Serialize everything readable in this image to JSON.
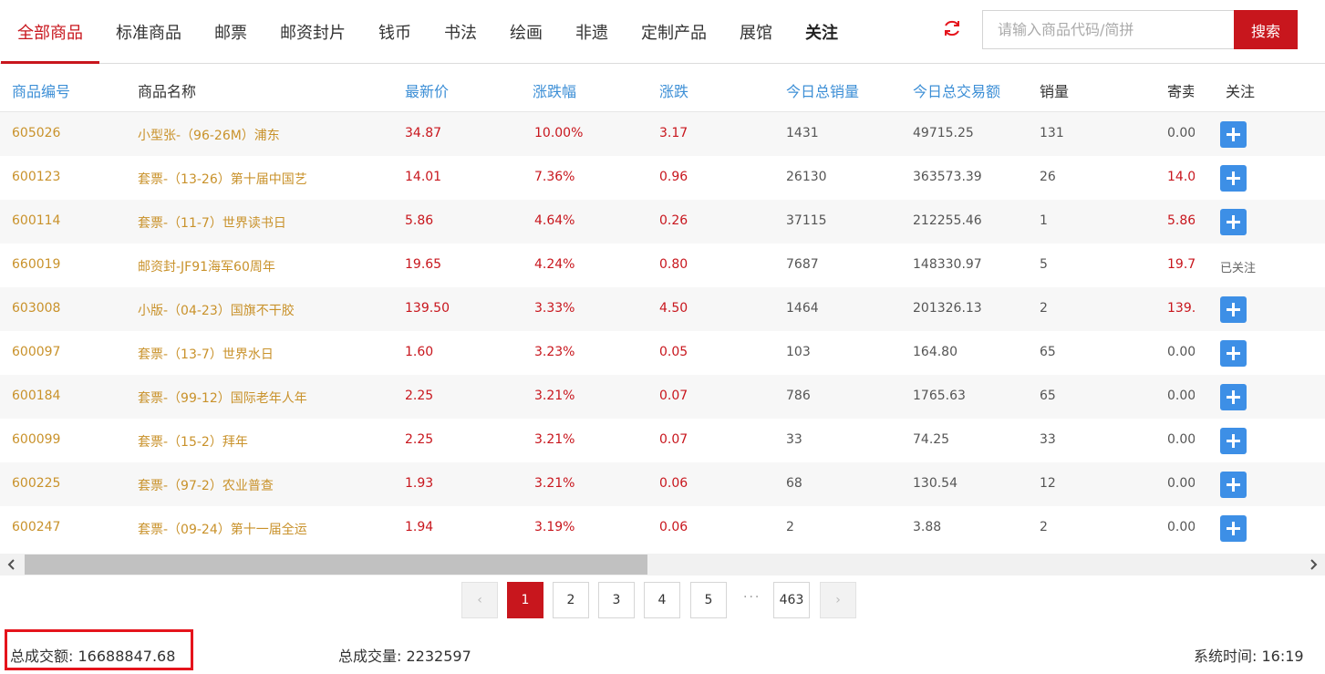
{
  "nav": {
    "tabs": [
      "全部商品",
      "标准商品",
      "邮票",
      "邮资封片",
      "钱币",
      "书法",
      "绘画",
      "非遗",
      "定制产品",
      "展馆",
      "关注"
    ],
    "active_tab": "全部商品"
  },
  "search": {
    "placeholder": "请输入商品代码/简拼",
    "button_label": "搜索"
  },
  "table": {
    "headers": [
      "商品编号",
      "商品名称",
      "最新价",
      "涨跌幅",
      "涨跌",
      "今日总销量",
      "今日总交易额",
      "销量",
      "寄卖",
      "关注"
    ],
    "rows": [
      {
        "code": "605026",
        "name": "小型张-（96-26M）浦东",
        "price": "34.87",
        "pct": "10.00%",
        "chg": "3.17",
        "vol": "1431",
        "amount": "49715.25",
        "sales": "131",
        "consign": "0.00",
        "followed": false
      },
      {
        "code": "600123",
        "name": "套票-（13-26）第十届中国艺",
        "price": "14.01",
        "pct": "7.36%",
        "chg": "0.96",
        "vol": "26130",
        "amount": "363573.39",
        "sales": "26",
        "consign": "14.0",
        "followed": false
      },
      {
        "code": "600114",
        "name": "套票-（11-7）世界读书日",
        "price": "5.86",
        "pct": "4.64%",
        "chg": "0.26",
        "vol": "37115",
        "amount": "212255.46",
        "sales": "1",
        "consign": "5.86",
        "followed": false
      },
      {
        "code": "660019",
        "name": "邮资封-JF91海军60周年",
        "price": "19.65",
        "pct": "4.24%",
        "chg": "0.80",
        "vol": "7687",
        "amount": "148330.97",
        "sales": "5",
        "consign": "19.7",
        "followed": true,
        "followed_label": "已关注"
      },
      {
        "code": "603008",
        "name": "小版-（04-23）国旗不干胶",
        "price": "139.50",
        "pct": "3.33%",
        "chg": "4.50",
        "vol": "1464",
        "amount": "201326.13",
        "sales": "2",
        "consign": "139.",
        "followed": false
      },
      {
        "code": "600097",
        "name": "套票-（13-7）世界水日",
        "price": "1.60",
        "pct": "3.23%",
        "chg": "0.05",
        "vol": "103",
        "amount": "164.80",
        "sales": "65",
        "consign": "0.00",
        "followed": false
      },
      {
        "code": "600184",
        "name": "套票-（99-12）国际老年人年",
        "price": "2.25",
        "pct": "3.21%",
        "chg": "0.07",
        "vol": "786",
        "amount": "1765.63",
        "sales": "65",
        "consign": "0.00",
        "followed": false
      },
      {
        "code": "600099",
        "name": "套票-（15-2）拜年",
        "price": "2.25",
        "pct": "3.21%",
        "chg": "0.07",
        "vol": "33",
        "amount": "74.25",
        "sales": "33",
        "consign": "0.00",
        "followed": false
      },
      {
        "code": "600225",
        "name": "套票-（97-2）农业普查",
        "price": "1.93",
        "pct": "3.21%",
        "chg": "0.06",
        "vol": "68",
        "amount": "130.54",
        "sales": "12",
        "consign": "0.00",
        "followed": false
      },
      {
        "code": "600247",
        "name": "套票-（09-24）第十一届全运",
        "price": "1.94",
        "pct": "3.19%",
        "chg": "0.06",
        "vol": "2",
        "amount": "3.88",
        "sales": "2",
        "consign": "0.00",
        "followed": false
      }
    ]
  },
  "pagination": {
    "prev": "‹",
    "pages": [
      "1",
      "2",
      "3",
      "4",
      "5"
    ],
    "ellipsis": "···",
    "last": "463",
    "next": "›",
    "current": "1"
  },
  "footer": {
    "total_amount_label": "总成交额:",
    "total_amount": "16688847.68",
    "total_volume_label": "总成交量:",
    "total_volume": "2232597",
    "system_time_label": "系统时间:",
    "system_time": "16:19"
  },
  "colors": {
    "accent": "#c8161d",
    "link_blue": "#3d8fd6",
    "product_gold": "#c9922b",
    "add_button": "#3d8fe6",
    "highlight_box": "#e5141c"
  },
  "icons": {
    "refresh": "refresh-icon",
    "add": "plus-icon",
    "scroll_left": "chevron-left-icon",
    "scroll_right": "chevron-right-icon"
  }
}
